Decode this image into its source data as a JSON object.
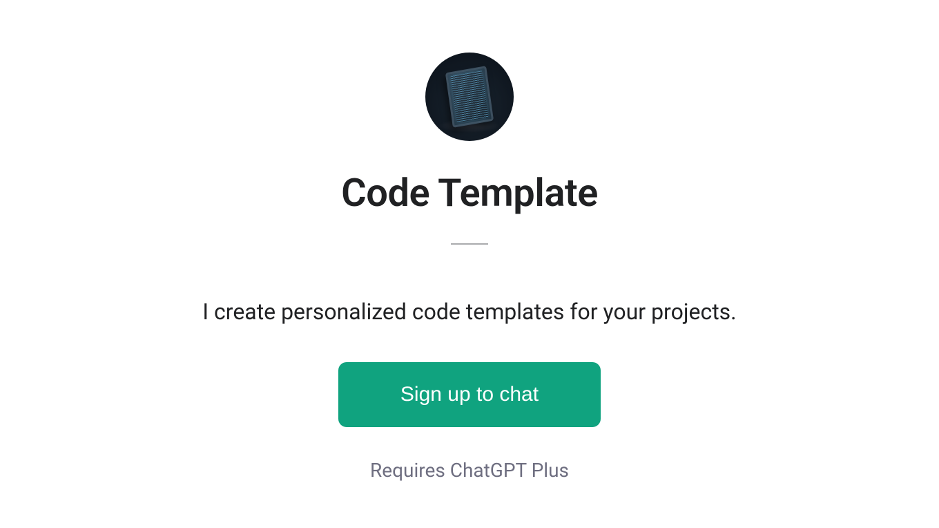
{
  "avatar": {
    "semantic": "code-tablet-icon"
  },
  "title": "Code Template",
  "description": "I create personalized code templates for your projects.",
  "cta": {
    "label": "Sign up to chat"
  },
  "requirement": "Requires ChatGPT Plus"
}
